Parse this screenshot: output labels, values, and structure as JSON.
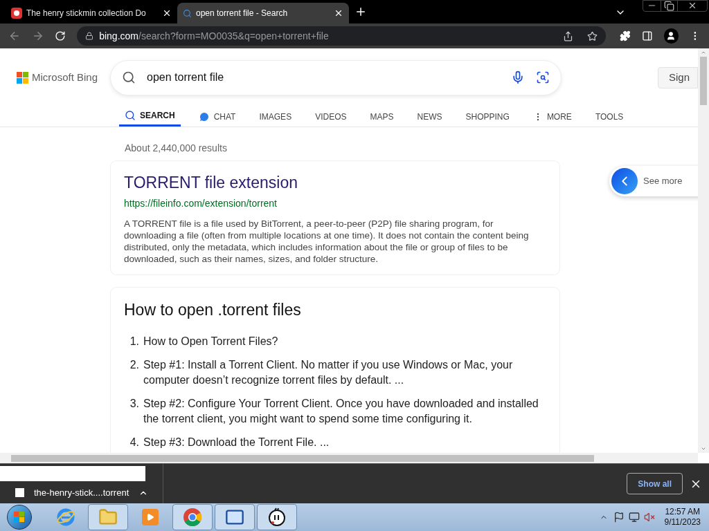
{
  "browser": {
    "tabs": [
      {
        "title": "The henry stickmin collection Do",
        "kind": "ghost",
        "selected": false
      },
      {
        "title": "open torrent file - Search",
        "kind": "search",
        "selected": true
      }
    ],
    "address": {
      "domain": "bing.com",
      "path": "/search?form=MO0035&q=open+torrent+file"
    }
  },
  "page": {
    "logo": "Microsoft Bing",
    "search": {
      "value": "open torrent file"
    },
    "sign_in": "Sign",
    "nav": [
      {
        "label": "SEARCH",
        "kind": "search",
        "selected": true
      },
      {
        "label": "CHAT",
        "kind": "chat",
        "selected": false
      },
      {
        "label": "IMAGES",
        "kind": "plain",
        "selected": false
      },
      {
        "label": "VIDEOS",
        "kind": "plain",
        "selected": false
      },
      {
        "label": "MAPS",
        "kind": "plain",
        "selected": false
      },
      {
        "label": "NEWS",
        "kind": "plain",
        "selected": false
      },
      {
        "label": "SHOPPING",
        "kind": "plain",
        "selected": false
      },
      {
        "label": "MORE",
        "kind": "more",
        "selected": false
      },
      {
        "label": "TOOLS",
        "kind": "plain",
        "selected": false
      }
    ],
    "results_count": "About 2,440,000 results",
    "result": {
      "title": "TORRENT file extension",
      "url": "https://fileinfo.com/extension/torrent",
      "snippet": "A TORRENT file is a file used by BitTorrent, a peer-to-peer (P2P) file sharing program, for downloading a file (often from multiple locations at one time). It does not contain the content being distributed, only the metadata, which includes information about the file or group of files to be downloaded, such as their names, sizes, and folder structure."
    },
    "see_more": "See more",
    "answer": {
      "title": "How to open .torrent files",
      "steps": [
        {
          "number": "1.",
          "text": "How to Open Torrent Files?"
        },
        {
          "number": "2.",
          "text": "Step #1: Install a Torrent Client. No matter if you use Windows or Mac, your computer doesn’t recognize torrent files by default. ..."
        },
        {
          "number": "3.",
          "text": "Step #2: Configure Your Torrent Client. Once you have downloaded and installed the torrent client, you might want to spend some time configuring it."
        },
        {
          "number": "4.",
          "text": "Step #3: Download the Torrent File. ..."
        }
      ]
    }
  },
  "downloads": {
    "file": "the-henry-stick....torrent",
    "show_all": "Show all"
  },
  "taskbar": {
    "apps": [
      {
        "kind": "ie",
        "running": false
      },
      {
        "kind": "folder",
        "running": true
      },
      {
        "kind": "media",
        "running": false
      },
      {
        "kind": "chrome",
        "running": true
      },
      {
        "kind": "keyboard",
        "running": true
      },
      {
        "kind": "face",
        "running": true
      }
    ],
    "time": "12:57 AM",
    "date": "9/11/2023"
  }
}
